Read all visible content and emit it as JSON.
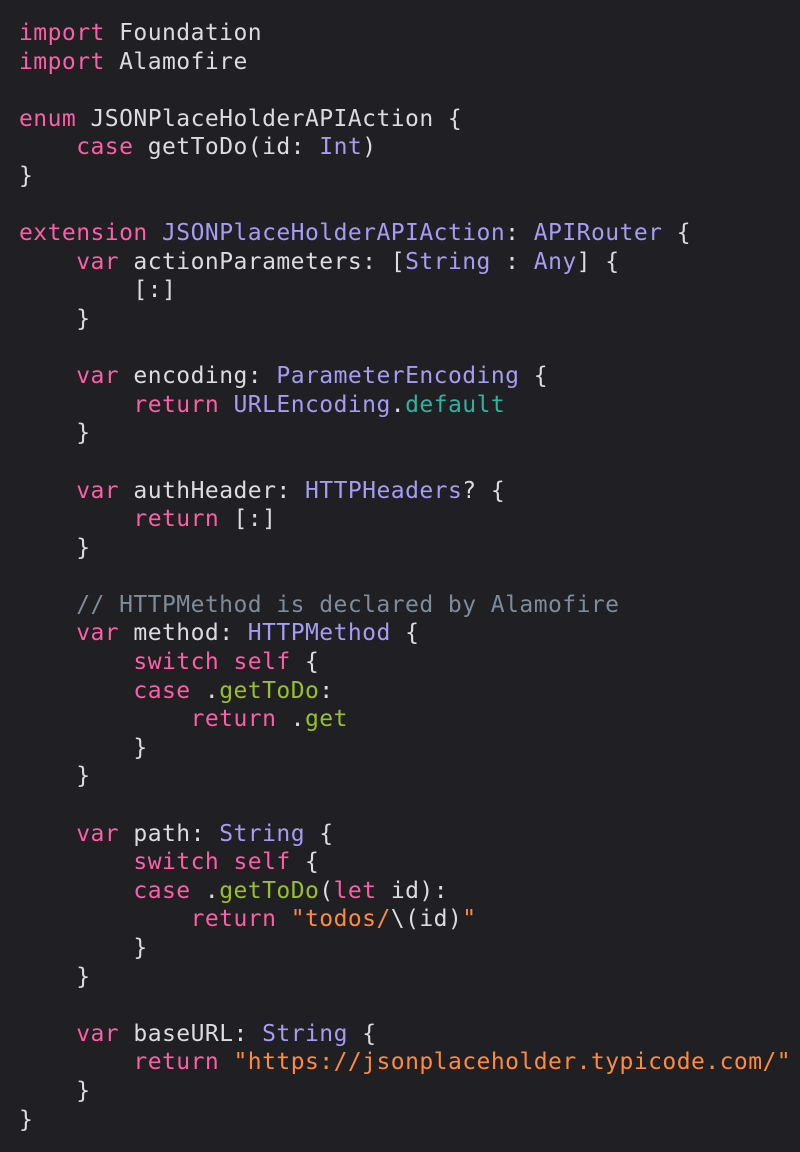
{
  "editor": {
    "language": "swift",
    "colors": {
      "background": "#1f1f24",
      "plain": "#dcdcdd",
      "keyword": "#fc5fa3",
      "type": "#a79bf2",
      "member": "#2fb39e",
      "function": "#9bbf2b",
      "string": "#ff8a3d",
      "comment": "#7f8c98"
    },
    "lines": [
      [
        {
          "t": "import",
          "c": "kw"
        },
        {
          "t": " Foundation",
          "c": "pl"
        }
      ],
      [
        {
          "t": "import",
          "c": "kw"
        },
        {
          "t": " Alamofire",
          "c": "pl"
        }
      ],
      [],
      [
        {
          "t": "enum",
          "c": "kw"
        },
        {
          "t": " JSONPlaceHolderAPIAction {",
          "c": "pl"
        }
      ],
      [
        {
          "t": "    ",
          "c": "pl"
        },
        {
          "t": "case",
          "c": "kw"
        },
        {
          "t": " getToDo(id: ",
          "c": "pl"
        },
        {
          "t": "Int",
          "c": "ty"
        },
        {
          "t": ")",
          "c": "pl"
        }
      ],
      [
        {
          "t": "}",
          "c": "pl"
        }
      ],
      [],
      [
        {
          "t": "extension",
          "c": "kw"
        },
        {
          "t": " ",
          "c": "pl"
        },
        {
          "t": "JSONPlaceHolderAPIAction",
          "c": "ty"
        },
        {
          "t": ": ",
          "c": "pl"
        },
        {
          "t": "APIRouter",
          "c": "ty"
        },
        {
          "t": " {",
          "c": "pl"
        }
      ],
      [
        {
          "t": "    ",
          "c": "pl"
        },
        {
          "t": "var",
          "c": "kw"
        },
        {
          "t": " actionParameters: [",
          "c": "pl"
        },
        {
          "t": "String",
          "c": "ty"
        },
        {
          "t": " : ",
          "c": "pl"
        },
        {
          "t": "Any",
          "c": "ty"
        },
        {
          "t": "] {",
          "c": "pl"
        }
      ],
      [
        {
          "t": "        [:]",
          "c": "pl"
        }
      ],
      [
        {
          "t": "    }",
          "c": "pl"
        }
      ],
      [],
      [
        {
          "t": "    ",
          "c": "pl"
        },
        {
          "t": "var",
          "c": "kw"
        },
        {
          "t": " encoding: ",
          "c": "pl"
        },
        {
          "t": "ParameterEncoding",
          "c": "ty"
        },
        {
          "t": " {",
          "c": "pl"
        }
      ],
      [
        {
          "t": "        ",
          "c": "pl"
        },
        {
          "t": "return",
          "c": "kw"
        },
        {
          "t": " ",
          "c": "pl"
        },
        {
          "t": "URLEncoding",
          "c": "ty"
        },
        {
          "t": ".",
          "c": "pl"
        },
        {
          "t": "default",
          "c": "mem"
        }
      ],
      [
        {
          "t": "    }",
          "c": "pl"
        }
      ],
      [],
      [
        {
          "t": "    ",
          "c": "pl"
        },
        {
          "t": "var",
          "c": "kw"
        },
        {
          "t": " authHeader: ",
          "c": "pl"
        },
        {
          "t": "HTTPHeaders",
          "c": "ty"
        },
        {
          "t": "? {",
          "c": "pl"
        }
      ],
      [
        {
          "t": "        ",
          "c": "pl"
        },
        {
          "t": "return",
          "c": "kw"
        },
        {
          "t": " [:]",
          "c": "pl"
        }
      ],
      [
        {
          "t": "    }",
          "c": "pl"
        }
      ],
      [],
      [
        {
          "t": "    // HTTPMethod is declared by Alamofire",
          "c": "cmt"
        }
      ],
      [
        {
          "t": "    ",
          "c": "pl"
        },
        {
          "t": "var",
          "c": "kw"
        },
        {
          "t": " method: ",
          "c": "pl"
        },
        {
          "t": "HTTPMethod",
          "c": "ty"
        },
        {
          "t": " {",
          "c": "pl"
        }
      ],
      [
        {
          "t": "        ",
          "c": "pl"
        },
        {
          "t": "switch",
          "c": "kw"
        },
        {
          "t": " ",
          "c": "pl"
        },
        {
          "t": "self",
          "c": "kw"
        },
        {
          "t": " {",
          "c": "pl"
        }
      ],
      [
        {
          "t": "        ",
          "c": "pl"
        },
        {
          "t": "case",
          "c": "kw"
        },
        {
          "t": " .",
          "c": "pl"
        },
        {
          "t": "getToDo",
          "c": "fn"
        },
        {
          "t": ":",
          "c": "pl"
        }
      ],
      [
        {
          "t": "            ",
          "c": "pl"
        },
        {
          "t": "return",
          "c": "kw"
        },
        {
          "t": " .",
          "c": "pl"
        },
        {
          "t": "get",
          "c": "fn"
        }
      ],
      [
        {
          "t": "        }",
          "c": "pl"
        }
      ],
      [
        {
          "t": "    }",
          "c": "pl"
        }
      ],
      [],
      [
        {
          "t": "    ",
          "c": "pl"
        },
        {
          "t": "var",
          "c": "kw"
        },
        {
          "t": " path: ",
          "c": "pl"
        },
        {
          "t": "String",
          "c": "ty"
        },
        {
          "t": " {",
          "c": "pl"
        }
      ],
      [
        {
          "t": "        ",
          "c": "pl"
        },
        {
          "t": "switch",
          "c": "kw"
        },
        {
          "t": " ",
          "c": "pl"
        },
        {
          "t": "self",
          "c": "kw"
        },
        {
          "t": " {",
          "c": "pl"
        }
      ],
      [
        {
          "t": "        ",
          "c": "pl"
        },
        {
          "t": "case",
          "c": "kw"
        },
        {
          "t": " .",
          "c": "pl"
        },
        {
          "t": "getToDo",
          "c": "fn"
        },
        {
          "t": "(",
          "c": "pl"
        },
        {
          "t": "let",
          "c": "kw"
        },
        {
          "t": " id):",
          "c": "pl"
        }
      ],
      [
        {
          "t": "            ",
          "c": "pl"
        },
        {
          "t": "return",
          "c": "kw"
        },
        {
          "t": " ",
          "c": "pl"
        },
        {
          "t": "\"todos/",
          "c": "str2"
        },
        {
          "t": "\\(id)",
          "c": "pl"
        },
        {
          "t": "\"",
          "c": "str2"
        }
      ],
      [
        {
          "t": "        }",
          "c": "pl"
        }
      ],
      [
        {
          "t": "    }",
          "c": "pl"
        }
      ],
      [],
      [
        {
          "t": "    ",
          "c": "pl"
        },
        {
          "t": "var",
          "c": "kw"
        },
        {
          "t": " baseURL: ",
          "c": "pl"
        },
        {
          "t": "String",
          "c": "ty"
        },
        {
          "t": " {",
          "c": "pl"
        }
      ],
      [
        {
          "t": "        ",
          "c": "pl"
        },
        {
          "t": "return",
          "c": "kw"
        },
        {
          "t": " ",
          "c": "pl"
        },
        {
          "t": "\"https://jsonplaceholder.typicode.com/\"",
          "c": "str2"
        }
      ],
      [
        {
          "t": "    }",
          "c": "pl"
        }
      ],
      [
        {
          "t": "}",
          "c": "pl"
        }
      ]
    ]
  }
}
